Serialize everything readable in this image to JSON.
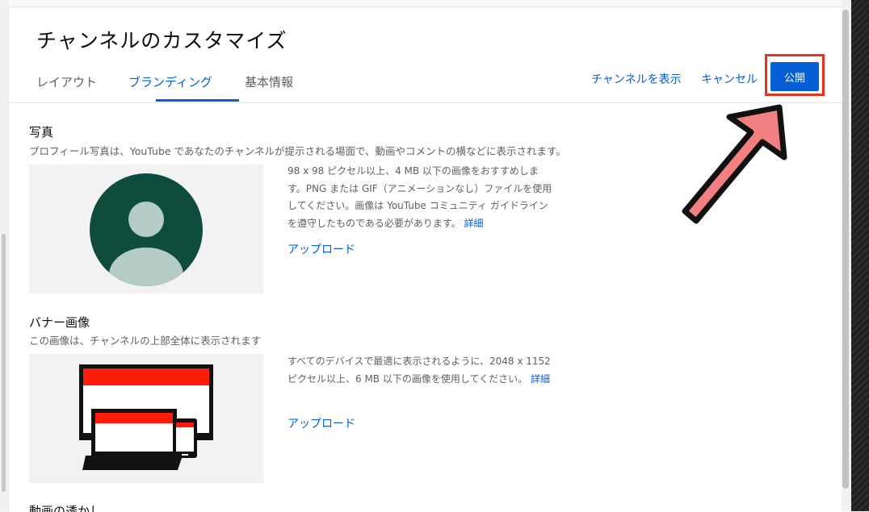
{
  "page_title": "チャンネルのカスタマイズ",
  "tabs": [
    {
      "label": "レイアウト"
    },
    {
      "label": "ブランディング"
    },
    {
      "label": "基本情報"
    }
  ],
  "header_actions": {
    "view_channel": "チャンネルを表示",
    "cancel": "キャンセル",
    "publish": "公開"
  },
  "photo": {
    "title": "写真",
    "description": "プロフィール写真は、YouTube であなたのチャンネルが提示される場面で、動画やコメントの横などに表示されます。",
    "info": "98 x 98 ピクセル以上、4 MB 以下の画像をおすすめします。PNG または GIF（アニメーションなし）ファイルを使用してください。画像は YouTube コミュニティ ガイドラインを遵守したものである必要があります。",
    "learn_more": "詳細",
    "upload": "アップロード"
  },
  "banner": {
    "title": "バナー画像",
    "description": "この画像は、チャンネルの上部全体に表示されます",
    "info": "すべてのデバイスで最適に表示されるように、2048 x 1152 ピクセル以上、6 MB 以下の画像を使用してください。",
    "learn_more": "詳細",
    "upload": "アップロード"
  },
  "watermark": {
    "title": "動画の透かし"
  },
  "colors": {
    "accent": "#065fd4",
    "highlight": "#e8321e",
    "arrow": "#f28080",
    "avatar_bg": "#0e4c3e",
    "avatar_fg": "#b4cbc6",
    "banner_red": "#ff1d0a"
  }
}
